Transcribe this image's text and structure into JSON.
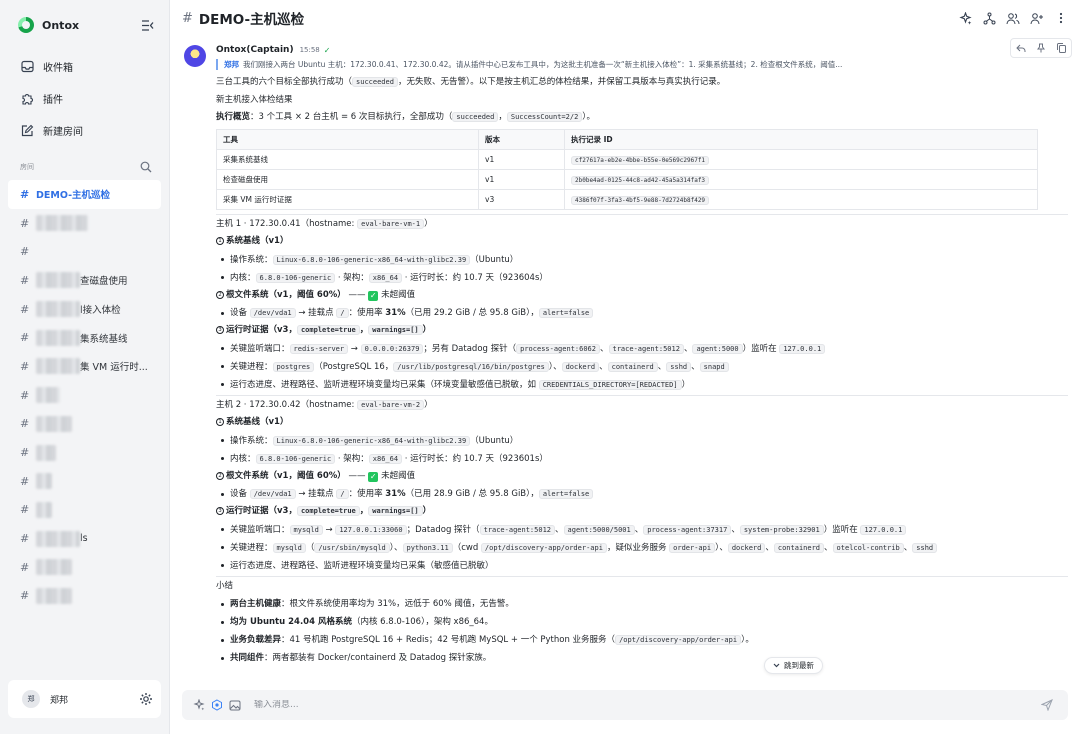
{
  "sidebar": {
    "brand": "Ontox",
    "nav": [
      {
        "label": "收件箱",
        "icon": "inbox-icon"
      },
      {
        "label": "插件",
        "icon": "puzzle-icon"
      },
      {
        "label": "新建房间",
        "icon": "new-room-icon"
      }
    ],
    "rooms_title": "房间",
    "active_room": "DEMO-主机巡检",
    "rooms_partial": [
      "查磁盘使用",
      "l接入体检",
      "集系统基线",
      "集 VM 运行时..."
    ],
    "rooms_partial_last": "ls",
    "user": {
      "avatar_text": "郑",
      "name": "郑邦"
    }
  },
  "header": {
    "title": "DEMO-主机巡检"
  },
  "message": {
    "author": "Ontox(Captain)",
    "time": "15:58",
    "reply_to": {
      "user": "郑邦",
      "text": "我们刚接入两台 Ubuntu 主机：172.30.0.41、172.30.0.42。请从插件中心已发布工具中，为这批主机准备一次“新主机接入体检”：1. 采集系统基线；2. 检查根文件系统，阈值..."
    },
    "intro": {
      "a": "三台工具的六个目标全部执行成功（",
      "code": "succeeded",
      "b": "，无失败、无告警）。以下是按主机汇总的体检结果，并保留工具版本与真实执行记录。"
    },
    "report_title": "新主机接入体检结果",
    "overview": {
      "label": "执行概览",
      "a": "：3 个工具 × 2 台主机 = 6 次目标执行，全部成功（",
      "code1": "succeeded",
      "sep": "，",
      "code2": "SuccessCount=2/2",
      "b": "）。"
    },
    "table": {
      "headers": [
        "工具",
        "版本",
        "执行记录 ID"
      ],
      "rows": [
        [
          "采集系统基线",
          "v1",
          "cf27617a-eb2e-4bbe-b55e-0e569c2967f1"
        ],
        [
          "检查磁盘使用",
          "v1",
          "2b0be4ad-0125-44c8-ad42-45a5a314faf3"
        ],
        [
          "采集 VM 运行时证据",
          "v3",
          "4386f07f-3fa3-4bf5-9e88-7d2724b8f429"
        ]
      ]
    },
    "host1": {
      "title": "主机 1 · 172.30.0.41（hostname: ",
      "hostname": "eval-bare-vm-1",
      "close": "）",
      "s1": {
        "num": "1",
        "title": "系统基线（v1）"
      },
      "os": {
        "label": "操作系统：",
        "code": "Linux-6.8.0-106-generic-x86_64-with-glibc2.39",
        "suffix": "（Ubuntu）"
      },
      "kernel": {
        "label": "内核：",
        "code1": "6.8.0-106-generic",
        "arch": " · 架构：",
        "code2": "x86_64",
        "uptime": " · 运行时长：约 10.7 天（923604s）"
      },
      "s2": {
        "num": "2",
        "title": "根文件系统（v1，阈值 60%）",
        "dash": " —— ",
        "ok": "✓",
        "status": "未超阈值"
      },
      "disk": {
        "label": "设备 ",
        "code1": "/dev/vda1",
        "arrow": " → 挂载点 ",
        "code2": "/",
        "usage_a": "：使用率 ",
        "usage": "31%",
        "usage_b": "（已用 29.2 GiB / 总 95.8 GiB），",
        "code3": "alert=false"
      },
      "s3": {
        "num": "3",
        "title": "运行时证据（v3，",
        "code1": "complete=true",
        "sep": "，",
        "code2": "warnings=[]",
        "close": "）"
      },
      "ports": {
        "label": "关键监听端口：",
        "c1": "redis-server",
        "arrow": " → ",
        "c2": "0.0.0.0:26379",
        "mid": "；另有 Datadog 探针（",
        "c3": "process-agent:6062",
        "s1": "、",
        "c4": "trace-agent:5012",
        "s2": "、",
        "c5": "agent:5000",
        "end": "）监听在 ",
        "c6": "127.0.0.1"
      },
      "procs": {
        "label": "关键进程：",
        "c1": "postgres",
        "mid": "（PostgreSQL 16，",
        "c2": "/usr/lib/postgresql/16/bin/postgres",
        "close": "）、",
        "c3": "dockerd",
        "s1": "、",
        "c4": "containerd",
        "s2": "、",
        "c5": "sshd",
        "s3": "、",
        "c6": "snapd"
      },
      "env": {
        "text": "运行态进度、进程路径、监听进程环境变量均已采集（环境变量敏感值已脱敏，如 ",
        "code": "CREDENTIALS_DIRECTORY=[REDACTED]",
        "close": "）"
      }
    },
    "host2": {
      "title": "主机 2 · 172.30.0.42（hostname: ",
      "hostname": "eval-bare-vm-2",
      "close": "）",
      "s1": {
        "num": "1",
        "title": "系统基线（v1）"
      },
      "os": {
        "label": "操作系统：",
        "code": "Linux-6.8.0-106-generic-x86_64-with-glibc2.39",
        "suffix": "（Ubuntu）"
      },
      "kernel": {
        "label": "内核：",
        "code1": "6.8.0-106-generic",
        "arch": " · 架构：",
        "code2": "x86_64",
        "uptime": " · 运行时长：约 10.7 天（923601s）"
      },
      "s2": {
        "num": "2",
        "title": "根文件系统（v1，阈值 60%）",
        "dash": " —— ",
        "ok": "✓",
        "status": "未超阈值"
      },
      "disk": {
        "label": "设备 ",
        "code1": "/dev/vda1",
        "arrow": " → 挂载点 ",
        "code2": "/",
        "usage_a": "：使用率 ",
        "usage": "31%",
        "usage_b": "（已用 28.9 GiB / 总 95.8 GiB），",
        "code3": "alert=false"
      },
      "s3": {
        "num": "3",
        "title": "运行时证据（v3，",
        "code1": "complete=true",
        "sep": "，",
        "code2": "warnings=[]",
        "close": "）"
      },
      "ports": {
        "label": "关键监听端口：",
        "c1": "mysqld",
        "arrow": " → ",
        "c2": "127.0.0.1:33060",
        "mid": "；Datadog 探针（",
        "c3": "trace-agent:5012",
        "s1": "、",
        "c4": "agent:5000/5001",
        "s2": "、",
        "c5": "process-agent:37317",
        "s3": "、",
        "c6": "system-probe:32901",
        "end": "）监听在 ",
        "c7": "127.0.0.1"
      },
      "procs": {
        "label": "关键进程：",
        "c1": "mysqld",
        "p1": "（",
        "c2": "/usr/sbin/mysqld",
        "close": "）、",
        "c3": "python3.11",
        "mid": "（cwd ",
        "c4": "/opt/discovery-app/order-api",
        "mid2": "，疑似业务服务 ",
        "c5": "order-api",
        "s1": "）、",
        "c6": "dockerd",
        "s2": "、",
        "c7": "containerd",
        "s3": "、",
        "c8": "otelcol-contrib",
        "s4": "、",
        "c9": "sshd"
      },
      "env": {
        "text": "运行态进度、进程路径、监听进程环境变量均已采集（敏感值已脱敏）"
      }
    },
    "summary": {
      "title": "小结",
      "items": [
        {
          "bold": "两台主机健康",
          "text": "：根文件系统使用率均为 31%，远低于 60% 阈值，无告警。"
        },
        {
          "bold": "均为 Ubuntu 24.04 风格系统",
          "text": "（内核 6.8.0-106），架构 x86_64。"
        },
        {
          "bold": "业务负载差异",
          "text": "：41 号机跑 PostgreSQL 16 + Redis；42 号机跑 MySQL + 一个 Python 业务服务（",
          "code": "/opt/discovery-app/order-api",
          "close": "）。"
        },
        {
          "bold": "共同组件",
          "text": "：两者都装有 Docker/containerd 及 Datadog 探针家族。"
        }
      ]
    }
  },
  "jump_label": "跳到最新",
  "composer": {
    "placeholder": "输入消息..."
  }
}
